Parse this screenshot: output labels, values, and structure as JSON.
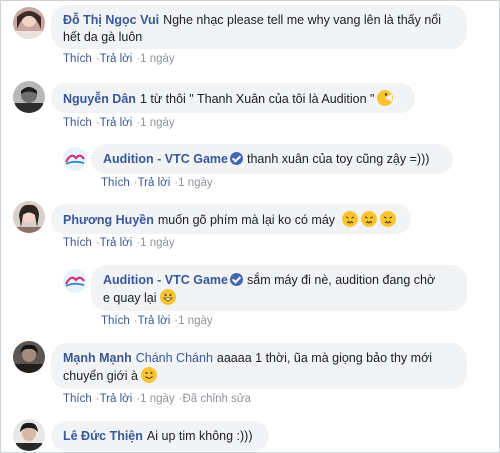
{
  "comments": [
    {
      "author": "Đỗ Thị Ngọc Vui",
      "text": "Nghe nhạc please tell me why vang lên là thấy nổi hết da gà luôn",
      "line1": "Nghe nhạc please tell me why vang lên là thấy nổi",
      "line2": "hết da gà luôn",
      "like": "Thích",
      "reply": "Trả lời",
      "time": "1 ngày"
    },
    {
      "author": "Nguyễn Dân",
      "text": "1 từ thôi \" Thanh Xuân của tôi là Audition \"",
      "like": "Thích",
      "reply": "Trả lời",
      "time": "1 ngày",
      "emoji": "pacman-emoji"
    },
    {
      "author": "Audition - VTC Game",
      "text": "thanh xuân của toy cũng zậy =)))",
      "like": "Thích",
      "reply": "Trả lời",
      "time": "1 ngày",
      "verified": true
    },
    {
      "author": "Phương Huyền",
      "text": "muốn gõ phím mà lại ko có máy",
      "like": "Thích",
      "reply": "Trả lời",
      "time": "1 ngày",
      "emoji": "confounded-emoji"
    },
    {
      "author": "Audition - VTC Game",
      "line1": "sắm máy đi nè, audition đang chờ",
      "line2": "e quay lại",
      "like": "Thích",
      "reply": "Trả lời",
      "time": "1 ngày",
      "verified": true,
      "emoji": "grinning-emoji"
    },
    {
      "author": "Mạnh Mạnh",
      "tag": "Chánh Chánh",
      "line1": "aaaaa 1 thời, ũa mà giọng bảo thy mới",
      "line2": "chuyển giới à",
      "like": "Thích",
      "reply": "Trả lời",
      "time": "1 ngày",
      "edited": "Đã chỉnh sửa",
      "emoji": "smile-emoji"
    },
    {
      "author": "Lê Đức Thiện",
      "text": "Ai up tim không :)))"
    }
  ],
  "colors": {
    "bubble": "#f2f3f5",
    "author": "#385898",
    "meta": "#90949c",
    "emoji": "#f7c531"
  }
}
